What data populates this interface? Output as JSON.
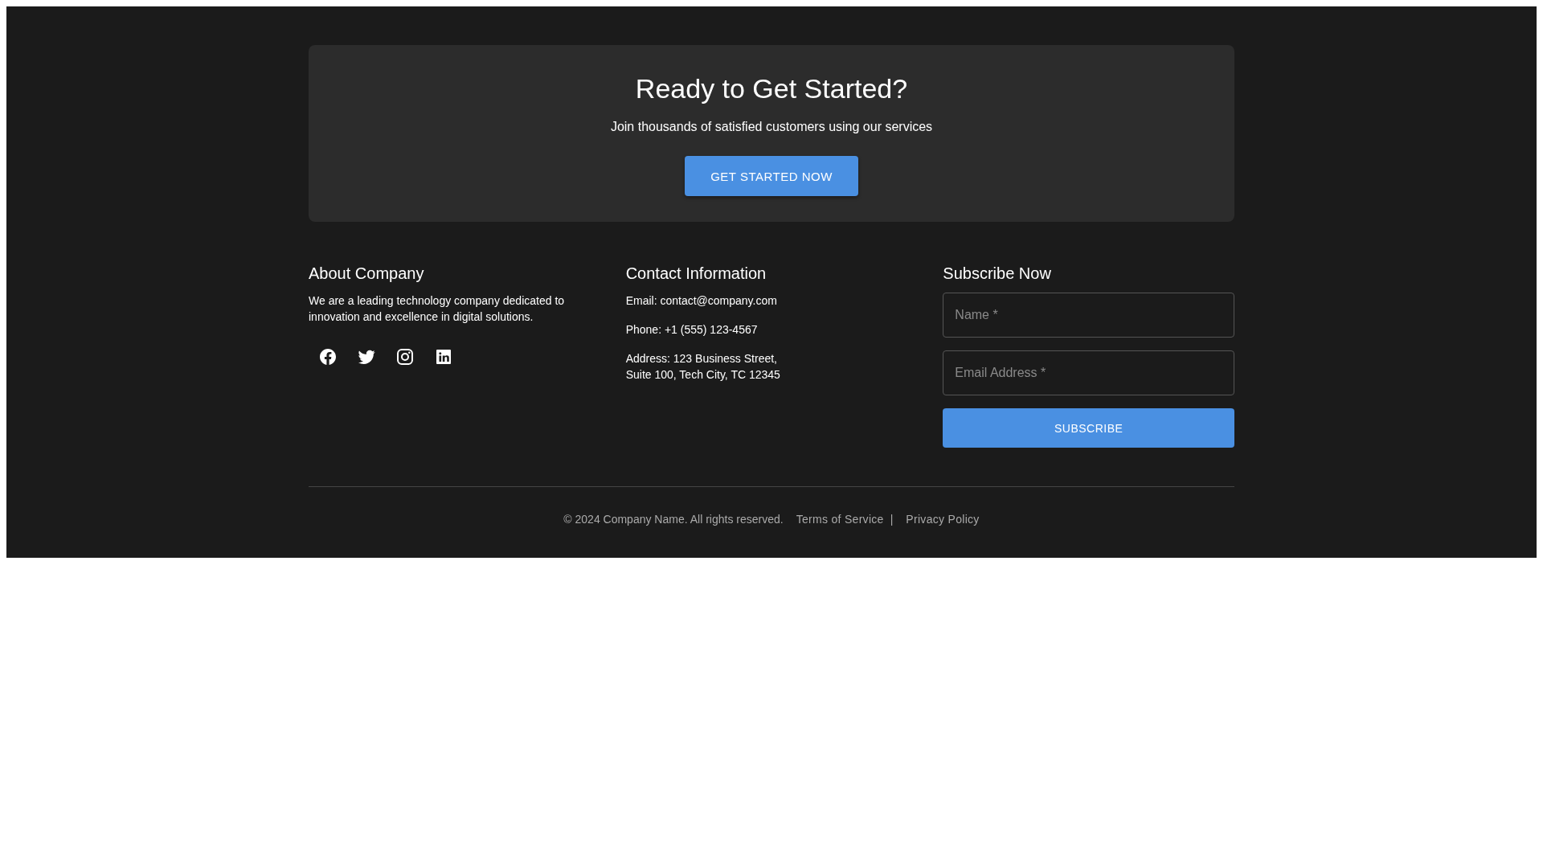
{
  "cta": {
    "title": "Ready to Get Started?",
    "subtitle": "Join thousands of satisfied customers using our services",
    "button": "GET STARTED NOW"
  },
  "about": {
    "heading": "About Company",
    "text": "We are a leading technology company dedicated to innovation and excellence in digital solutions.",
    "social": [
      {
        "kind": "facebook"
      },
      {
        "kind": "twitter"
      },
      {
        "kind": "instagram"
      },
      {
        "kind": "linkedin"
      }
    ]
  },
  "contact": {
    "heading": "Contact Information",
    "lines": [
      "Email: contact@company.com",
      "Phone: +1 (555) 123-4567",
      "Address: 123 Business Street,\nSuite 100, Tech City, TC 12345"
    ]
  },
  "subscribe": {
    "heading": "Subscribe Now",
    "fields": [
      {
        "placeholder": "Name *"
      },
      {
        "placeholder": "Email Address *"
      }
    ],
    "button": "SUBSCRIBE"
  },
  "bottom": {
    "copyright": "© 2024 Company Name. All rights reserved.",
    "links": [
      "Terms of Service",
      "Privacy Policy"
    ],
    "separator": "|"
  }
}
